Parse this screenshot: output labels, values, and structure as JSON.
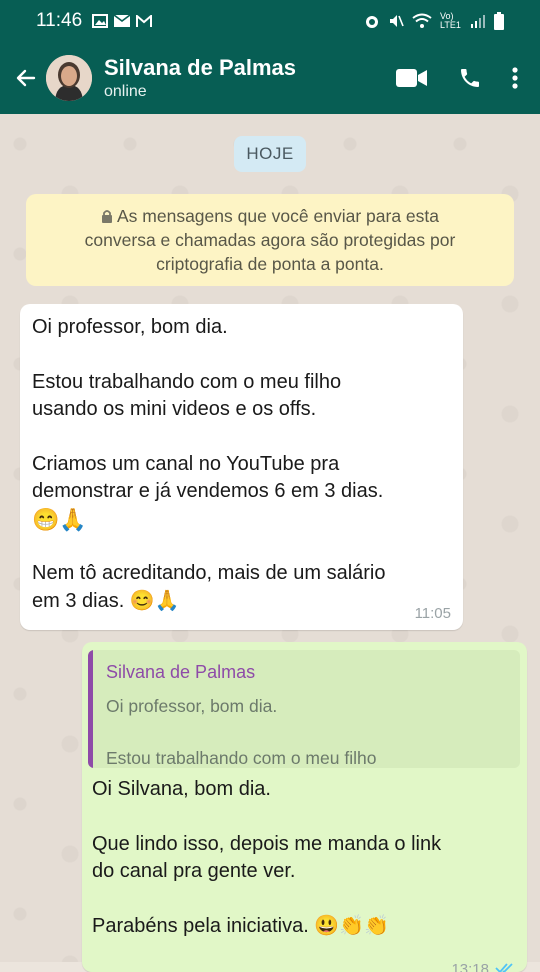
{
  "statusbar": {
    "time": "11:46",
    "network": "Vo) LTE1"
  },
  "header": {
    "name": "Silvana de Palmas",
    "status": "online"
  },
  "chat": {
    "date_chip": "HOJE",
    "encryption_note": {
      "line1": "As mensagens que você enviar para esta",
      "line2": "conversa e chamadas agora são protegidas por",
      "line3": "criptografia de ponta a ponta."
    },
    "incoming": {
      "p1": "Oi professor, bom dia.",
      "p2_l1": "Estou trabalhando com o meu filho",
      "p2_l2": "usando os mini videos e os offs.",
      "p3_l1": "Criamos um canal no YouTube pra",
      "p3_l2": "demonstrar e já vendemos 6 em 3 dias.",
      "p3_l3": "😁🙏",
      "p4_l1": "Nem tô acreditando, mais de um salário",
      "p4_l2": "em 3 dias. 😊🙏",
      "time": "11:05"
    },
    "outgoing": {
      "quote": {
        "author": "Silvana de Palmas",
        "line1": "Oi professor, bom dia.",
        "line2": "Estou trabalhando com o meu filho"
      },
      "p1": "Oi Silvana, bom dia.",
      "p2_l1": "Que lindo isso, depois me manda o link",
      "p2_l2": "do canal pra gente ver.",
      "p3": "Parabéns pela iniciativa. 😃👏👏",
      "time": "13:18"
    }
  },
  "colors": {
    "header": "#075e54",
    "incoming_bubble": "#ffffff",
    "outgoing_bubble": "#e1f7c7",
    "note_bg": "#fdf4c5",
    "quote_accent": "#8e4ba8",
    "read_ticks": "#4fc3f7"
  }
}
